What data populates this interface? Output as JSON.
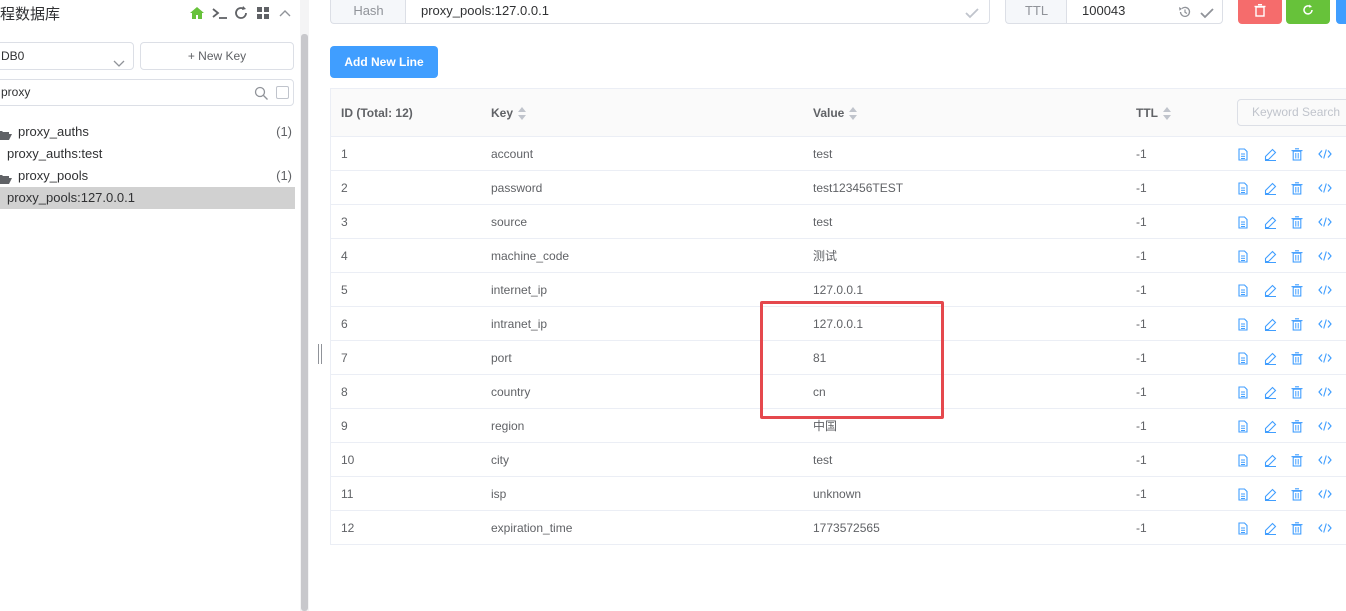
{
  "sidebar": {
    "title": "程数据库",
    "db_select": "DB0",
    "new_key_label": "+ New Key",
    "search_value": "proxy",
    "tree": [
      {
        "label": "proxy_auths",
        "count": "(1)",
        "type": "folder"
      },
      {
        "label": "proxy_auths:test",
        "type": "leaf"
      },
      {
        "label": "proxy_pools",
        "count": "(1)",
        "type": "folder"
      },
      {
        "label": "proxy_pools:127.0.0.1",
        "type": "leaf",
        "selected": true
      }
    ]
  },
  "topbar": {
    "type_label": "Hash",
    "key_value": "proxy_pools:127.0.0.1",
    "ttl_label": "TTL",
    "ttl_value": "100043"
  },
  "add_line_label": "Add New Line",
  "table": {
    "headers": {
      "id": "ID (Total: 12)",
      "key": "Key",
      "value": "Value",
      "ttl": "TTL",
      "search_placeholder": "Keyword Search"
    },
    "rows": [
      {
        "id": "1",
        "key": "account",
        "value": "test",
        "ttl": "-1"
      },
      {
        "id": "2",
        "key": "password",
        "value": "test123456TEST",
        "ttl": "-1"
      },
      {
        "id": "3",
        "key": "source",
        "value": "test",
        "ttl": "-1"
      },
      {
        "id": "4",
        "key": "machine_code",
        "value": "测试",
        "ttl": "-1"
      },
      {
        "id": "5",
        "key": "internet_ip",
        "value": "127.0.0.1",
        "ttl": "-1"
      },
      {
        "id": "6",
        "key": "intranet_ip",
        "value": "127.0.0.1",
        "ttl": "-1"
      },
      {
        "id": "7",
        "key": "port",
        "value": "81",
        "ttl": "-1"
      },
      {
        "id": "8",
        "key": "country",
        "value": "cn",
        "ttl": "-1"
      },
      {
        "id": "9",
        "key": "region",
        "value": "中国",
        "ttl": "-1"
      },
      {
        "id": "10",
        "key": "city",
        "value": "test",
        "ttl": "-1"
      },
      {
        "id": "11",
        "key": "isp",
        "value": "unknown",
        "ttl": "-1"
      },
      {
        "id": "12",
        "key": "expiration_time",
        "value": "1773572565",
        "ttl": "-1"
      }
    ]
  },
  "colors": {
    "primary": "#409eff",
    "danger": "#f56c6c",
    "success": "#67c23a",
    "icon_blue": "#409eff",
    "highlight_red": "#e5484d"
  },
  "icons": {
    "row_actions": [
      "document-icon",
      "edit-icon",
      "trash-icon",
      "code-icon"
    ],
    "sidebar_tools": [
      "home-icon",
      "terminal-icon",
      "refresh-icon",
      "grid-icon",
      "chevron-up-icon"
    ]
  }
}
